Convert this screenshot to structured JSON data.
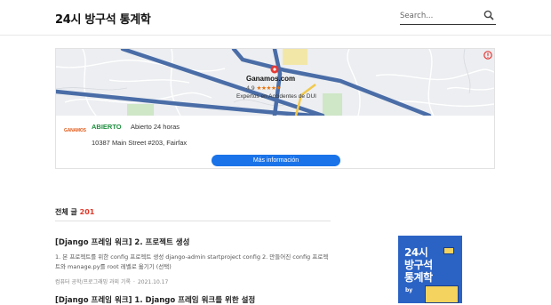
{
  "header": {
    "blog_title": "24시 방구석 통계학",
    "search_placeholder": "Search..."
  },
  "ad": {
    "business_name": "Ganamos.com",
    "rating": "4.9",
    "stars": "★★★★★",
    "subtitle": "Expertos en Accidentes de DUI",
    "logo_text": "GANAMOS",
    "status": "ABIERTO",
    "hours": "Abierto 24 horas",
    "address": "10387 Main Street #203, Fairfax",
    "button": "Más información"
  },
  "post_list": {
    "count_label": "전체 글",
    "count": "201",
    "posts": [
      {
        "title": "[Django 프레임 워크] 2. 프로젝트 생성",
        "excerpt": "1. 본 프로젝트를 위한 config 프로젝트 생성 django-admin startproject config 2. 만들어진 config 프로젝트와 manage.py를 root 레벨로 옮기기 (선택)",
        "category": "컴퓨터 공학/프로그래밍 과외 기록",
        "date": "2021.10.17"
      },
      {
        "title": "[Django 프레임 워크] 1. Django 프레임 워크를 위한 설정"
      }
    ]
  },
  "promo": {
    "line1": "24시",
    "line2": "방구석",
    "line3": "통계학",
    "by": "by"
  },
  "colors": {
    "accent_red": "#e0392b",
    "map_road": "#4a6da7",
    "button_blue": "#1a73e8",
    "open_green": "#1e8e3e",
    "promo_blue": "#2b63c4"
  }
}
